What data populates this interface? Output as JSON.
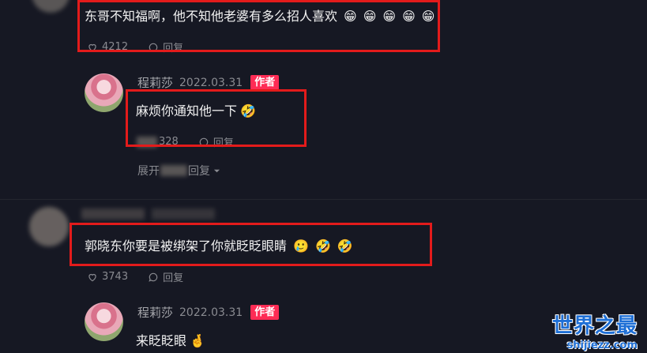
{
  "comments": [
    {
      "text": "东哥不知福啊，他不知他老婆有多么招人喜欢",
      "emojis": [
        "😁",
        "😁",
        "😁",
        "😁",
        "😁"
      ],
      "likes": "4212",
      "reply_label": "回复"
    },
    {
      "text": "郭晓东你要是被绑架了你就眨眨眼睛",
      "emojis": [
        "🥲",
        "🤣",
        "🤣"
      ],
      "likes": "3743",
      "reply_label": "回复"
    }
  ],
  "replies": [
    {
      "author": "程莉莎",
      "date": "2022.03.31",
      "badge": "作者",
      "text": "麻烦你通知他一下",
      "emoji": "🤣",
      "likes": "328",
      "reply_label": "回复",
      "expand_label": "展开",
      "expand_suffix": "回复"
    },
    {
      "author": "程莉莎",
      "date": "2022.03.31",
      "badge": "作者",
      "text": "来眨眨眼",
      "emoji": "🤞"
    }
  ],
  "watermark": {
    "title": "世界之最",
    "url": "shijiezz.com"
  },
  "colors": {
    "background": "#161823",
    "author_badge": "#fe2c55",
    "highlight_box": "#e31b1b",
    "watermark": "#1e6fd6"
  }
}
